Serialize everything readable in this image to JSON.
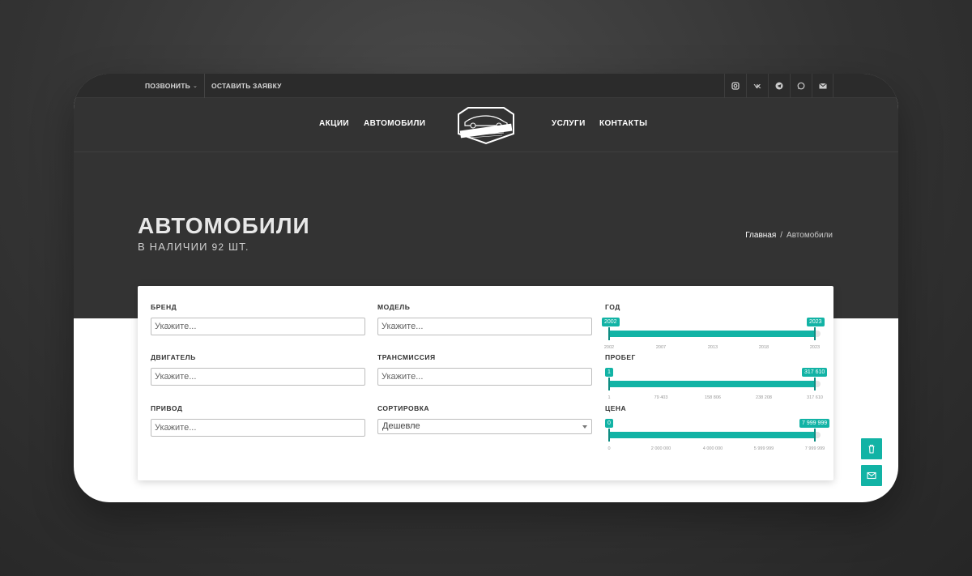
{
  "topbar": {
    "call_label": "ПОЗВОНИТЬ",
    "request_label": "ОСТАВИТЬ ЗАЯВКУ",
    "socials": [
      "instagram-icon",
      "vk-icon",
      "telegram-icon",
      "whatsapp-icon",
      "mail-icon"
    ]
  },
  "nav": {
    "items": [
      "АКЦИИ",
      "АВТОМОБИЛИ",
      "УСЛУГИ",
      "КОНТАКТЫ"
    ],
    "logo_text": "МИР ТЕХНИКИ"
  },
  "page": {
    "title": "АВТОМОБИЛИ",
    "subtitle_prefix": "В НАЛИЧИИ ",
    "subtitle_count": "92",
    "subtitle_suffix": " ШТ.",
    "breadcrumbs": [
      "Главная",
      "/",
      "Автомобили"
    ]
  },
  "filters": {
    "brand": {
      "label": "БРЕНД",
      "placeholder": "Укажите..."
    },
    "model": {
      "label": "МОДЕЛЬ",
      "placeholder": "Укажите..."
    },
    "engine": {
      "label": "ДВИГАТЕЛЬ",
      "placeholder": "Укажите..."
    },
    "transmission": {
      "label": "ТРАНСМИССИЯ",
      "placeholder": "Укажите..."
    },
    "drive": {
      "label": "ПРИВОД",
      "placeholder": "Укажите..."
    },
    "sort": {
      "label": "СОРТИРОВКА",
      "value": "Дешевле"
    },
    "year": {
      "label": "ГОД",
      "min": "2002",
      "max": "2023",
      "ticks": [
        "2002",
        "2007",
        "2013",
        "2018",
        "2023"
      ]
    },
    "mileage": {
      "label": "ПРОБЕГ",
      "min": "1",
      "max": "317 610",
      "ticks": [
        "1",
        "79 403",
        "158 806",
        "238 208",
        "317 610"
      ]
    },
    "price": {
      "label": "ЦЕНА",
      "min": "0",
      "max": "7 999 999",
      "ticks": [
        "0",
        "2 000 000",
        "4 000 000",
        "5 999 999",
        "7 999 999"
      ]
    }
  },
  "colors": {
    "accent": "#12b3a5",
    "dark_bg": "#333333",
    "topbar_bg": "#2b2b2b"
  },
  "fab": [
    "trash-icon",
    "mail-icon"
  ]
}
